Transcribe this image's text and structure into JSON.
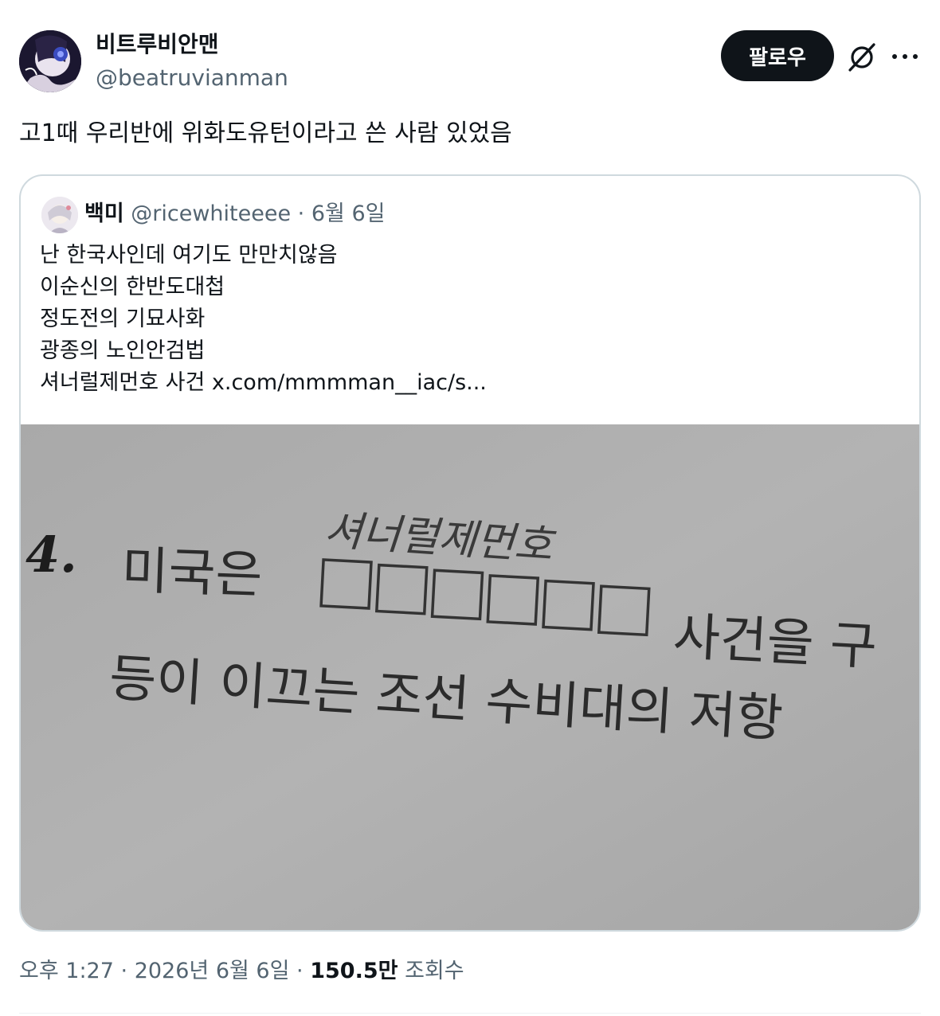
{
  "author": {
    "display_name": "비트루비안맨",
    "handle": "@beatruvianman"
  },
  "follow_label": "팔로우",
  "tweet": {
    "text": "고1때 우리반에 위화도유턴이라고 쓴 사람 있었음"
  },
  "quote": {
    "display_name": "백미",
    "handle": "@ricewhiteeee",
    "separator": "·",
    "date": "6월 6일",
    "lines": [
      "난 한국사인데 여기도 만만치않음",
      "이순신의 한반도대첩",
      "정도전의 기묘사화",
      "광종의 노인안검법",
      "셔너럴제먼호 사건"
    ],
    "link": "x.com/mmmman__iac/s...",
    "image": {
      "question_number": "4.",
      "line1_start": "미국은",
      "line1_end": "사건을 구",
      "line2": "등이 이끄는 조선 수비대의 저항",
      "handwriting": "셔너럴제먼호",
      "blank_box_count": 6
    }
  },
  "meta": {
    "time": "오후 1:27",
    "separator": "·",
    "date": "2026년 6월 6일",
    "views": "150.5만",
    "views_label": "조회수"
  },
  "colors": {
    "text": "#0f1419",
    "secondary": "#536471",
    "border": "#cfd9de",
    "button_bg": "#0f1419",
    "paper": "#aeaeae"
  },
  "icons": [
    "grok-icon",
    "more-icon"
  ]
}
